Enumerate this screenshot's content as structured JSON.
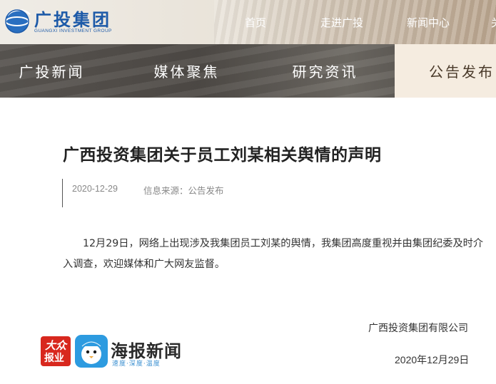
{
  "header": {
    "logo_cn": "广投集团",
    "logo_en": "GUANGXI INVESTMENT GROUP",
    "nav": [
      "首页",
      "走进广投",
      "新闻中心",
      "关"
    ]
  },
  "tabs": [
    {
      "label": "广投新闻",
      "active": false
    },
    {
      "label": "媒体聚焦",
      "active": false
    },
    {
      "label": "研究资讯",
      "active": false
    },
    {
      "label": "公告发布",
      "active": true
    }
  ],
  "article": {
    "title": "广西投资集团关于员工刘某相关舆情的声明",
    "date": "2020-12-29",
    "source": "信息来源：公告发布",
    "body": "12月29日，网络上出现涉及我集团员工刘某的舆情，我集团高度重视并由集团纪委及时介入调查，欢迎媒体和广大网友监督。",
    "signature_org": "广西投资集团有限公司",
    "signature_date": "2020年12月29日"
  },
  "watermark": {
    "badge_line1": "大众",
    "badge_line2": "报业",
    "name": "海报新闻",
    "tagline": "速度·深度·温度"
  },
  "colors": {
    "brand_blue": "#1d5aa8",
    "active_tab_bg": "#f5ece0",
    "band_bg": "#55514d",
    "watermark_red": "#d8281e",
    "watermark_blue": "#2d9be0"
  }
}
